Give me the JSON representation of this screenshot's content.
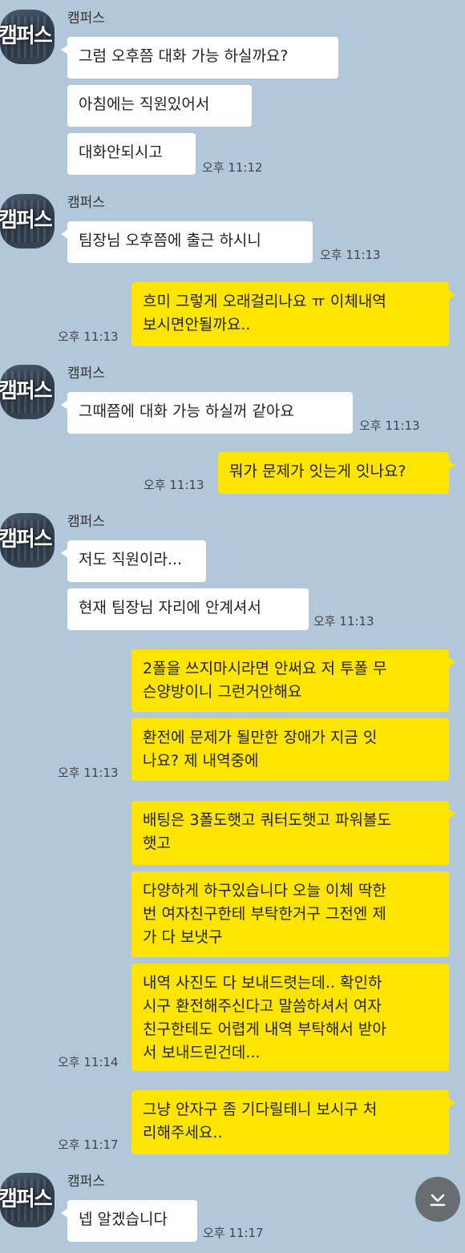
{
  "sender_name": "캠퍼스",
  "avatar_text": "캠퍼스",
  "colors": {
    "background": "#b2c7d9",
    "incoming": "#ffffff",
    "outgoing": "#fee500",
    "scroll_button": "#686d72"
  },
  "messages": [
    {
      "text": "그럼 오후쯤 대화 가능 하실까요?"
    },
    {
      "text": "아침에는 직원있어서"
    },
    {
      "text": "대화안되시고",
      "time": "오후 11:12"
    },
    {
      "text": "팀장님 오후쯤에 출근 하시니",
      "time": "오후 11:13"
    },
    {
      "text": "흐미 그렇게 오래걸리나요 ㅠ 이체내역\n보시면안될까요..",
      "time": "오후 11:13"
    },
    {
      "text": "그때쯤에 대화 가능 하실꺼 같아요",
      "time": "오후 11:13"
    },
    {
      "text": "뭐가 문제가 잇는게 잇나요?",
      "time": "오후 11:13"
    },
    {
      "text": "저도 직원이라..."
    },
    {
      "text": "현재 팀장님 자리에 안계셔서",
      "time": "오후 11:13"
    },
    {
      "text": "2폴을 쓰지마시라면 안써요 저 투폴 무\n슨양방이니 그런거안해요"
    },
    {
      "text": "환전에 문제가 될만한 장애가 지금 잇\n나요? 제 내역중에",
      "time": "오후 11:13"
    },
    {
      "text": "배팅은 3폴도햇고 쿼터도햇고 파워볼도\n햇고"
    },
    {
      "text": "다양하게 하구있습니다 오늘 이체 딱한\n번 여자친구한테 부탁한거구 그전엔 제\n가 다 보냇구"
    },
    {
      "text": "내역 사진도 다 보내드렷는데.. 확인하\n시구 환전해주신다고 말씀하셔서 여자\n친구한테도 어렵게 내역 부탁해서 받아\n서 보내드린건데...",
      "time": "오후 11:14"
    },
    {
      "text": "그냥 안자구 좀 기다릴테니 보시구 처\n리해주세요..",
      "time": "오후 11:17"
    },
    {
      "text": "넵 알겠습니다",
      "time": "오후 11:17"
    }
  ],
  "scroll_down_icon": "chevron-down-bar-icon"
}
